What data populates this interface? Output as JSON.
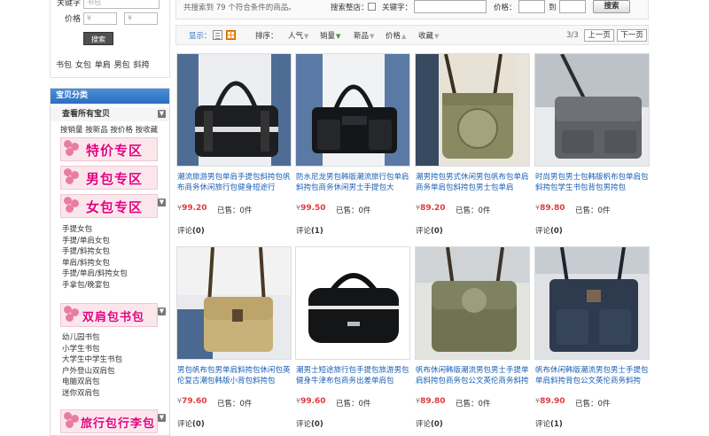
{
  "search": {
    "keyword_label": "关键字",
    "keyword_placeholder": "书包",
    "price_label": "价格",
    "price_min_placeholder": "¥",
    "price_max_placeholder": "¥",
    "search_button": "搜索",
    "hot_tags": "书包 女包 单肩 男包 斜挎"
  },
  "category": {
    "title": "宝贝分类",
    "all": "查看所有宝贝",
    "sort_links": "按销量 按新品 按价格 按收藏",
    "toggle_glyph": "▼",
    "banners": [
      "特价专区",
      "男包专区",
      "女包专区",
      "双肩包书包",
      "旅行包行李包"
    ],
    "women_items": [
      "手提女包",
      "手提/单肩女包",
      "手提/斜挎女包",
      "单肩/斜挎女包",
      "手提/单肩/斜挎女包",
      "手拿包/晚宴包"
    ],
    "backpack_items": [
      "幼儿园书包",
      "小学生书包",
      "大学生中学生书包",
      "户外登山双肩包",
      "电脑双肩包",
      "迷你双肩包"
    ]
  },
  "toolbar": {
    "result_text": "共搜索到 79 个符合条件的商品。",
    "filter_label": "搜索整店：",
    "keyword_label": "关键字：",
    "price_label": "价格：",
    "price_to": "到",
    "search_button": "搜索"
  },
  "sortbar": {
    "display_label": "显示：",
    "sort_label": "排序：",
    "options": [
      "人气",
      "销量",
      "新品",
      "价格",
      "收藏"
    ],
    "page_info": "3/3",
    "prev": "上一页",
    "next": "下一页"
  },
  "products": [
    {
      "name": "潮流旅游男包单肩手提包斜挎包帆布商务休闲旅行包健身短途行",
      "price": "99.20",
      "sold": "已售：0件",
      "review_label": "评论",
      "review_count": "(0)"
    },
    {
      "name": "防水尼龙男包韩版潮流旅行包单肩斜挎包商务休闲男士手提包大",
      "price": "99.50",
      "sold": "已售：0件",
      "review_label": "评论",
      "review_count": "(1)"
    },
    {
      "name": "潮男挎包男式休闲男包帆布包单肩商务单肩包斜挎包男士包单肩",
      "price": "89.20",
      "sold": "已售：0件",
      "review_label": "评论",
      "review_count": "(0)"
    },
    {
      "name": "时尚男包男士包韩版帆布包单肩包斜挎包学生书包背包男挎包",
      "price": "89.80",
      "sold": "已售：0件",
      "review_label": "评论",
      "review_count": "(0)"
    },
    {
      "name": "男包帆布包男单肩斜挎包休闲包英伦复古潮包韩版小背包斜挎包",
      "price": "79.60",
      "sold": "已售：0件",
      "review_label": "评论",
      "review_count": "(0)"
    },
    {
      "name": "潮男士短途旅行包手提包旅游男包健身牛津布包商务出差单肩包",
      "price": "99.60",
      "sold": "已售：0件",
      "review_label": "评论",
      "review_count": "(0)"
    },
    {
      "name": "帆布休闲韩版潮流男包男士手提单肩斜挎包商务包公文英伦商务斜挎",
      "price": "89.80",
      "sold": "已售：0件",
      "review_label": "评论",
      "review_count": "(0)"
    },
    {
      "name": "帆布休闲韩版潮流男包男士手提包单肩斜挎背包公文英伦商务斜挎",
      "price": "89.90",
      "sold": "已售：0件",
      "review_label": "评论",
      "review_count": "(1)"
    }
  ],
  "currency": "¥",
  "colors": {
    "price": "#e4393c",
    "link": "#1a5fb4",
    "category_header": "#2a6fc0",
    "banner_text": "#e4007f"
  }
}
